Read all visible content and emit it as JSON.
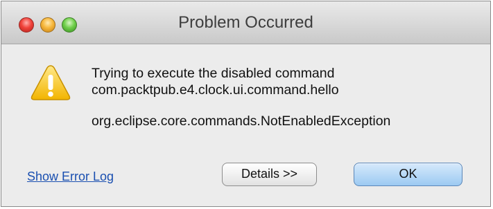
{
  "window": {
    "title": "Problem Occurred"
  },
  "message": {
    "line1": "Trying to execute the disabled command",
    "line2": "com.packtpub.e4.clock.ui.command.hello",
    "exception": "org.eclipse.core.commands.NotEnabledException"
  },
  "footer": {
    "link_label": "Show Error Log",
    "details_label": "Details >>",
    "ok_label": "OK"
  },
  "icons": {
    "warning": "warning-triangle-icon",
    "close": "close-traffic-light",
    "minimize": "minimize-traffic-light",
    "zoom": "zoom-traffic-light"
  },
  "colors": {
    "link": "#1a4fb0",
    "ok_button": "#9ccaf2",
    "warning": "#f5c518"
  }
}
